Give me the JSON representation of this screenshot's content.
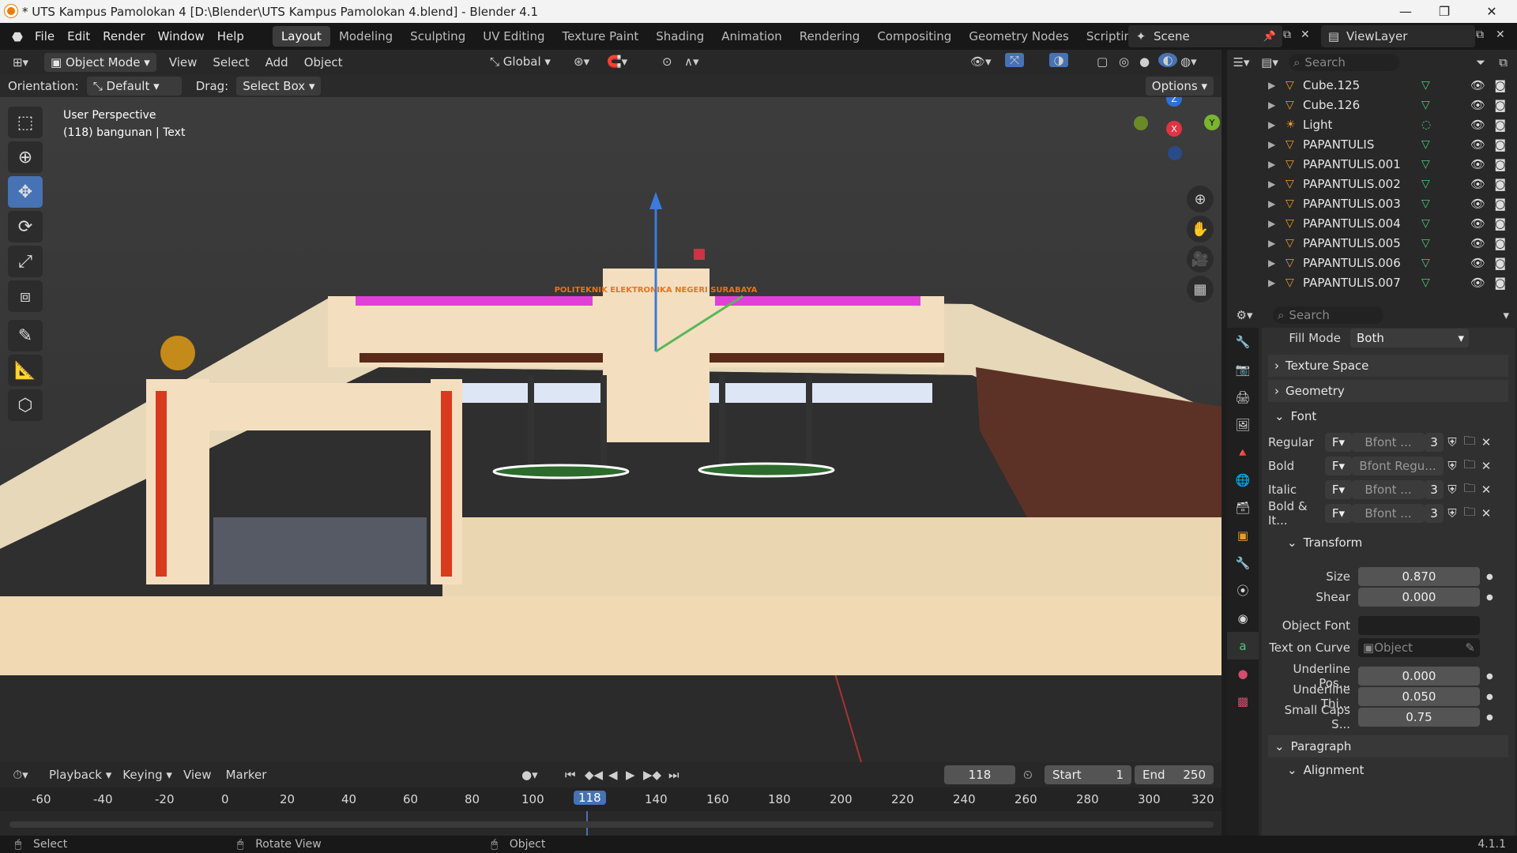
{
  "window": {
    "title": "* UTS Kampus Pamolokan 4 [D:\\Blender\\UTS Kampus Pamolokan 4.blend] - Blender 4.1",
    "controls": [
      "—",
      "❐",
      "✕"
    ]
  },
  "menubar": {
    "menus": [
      "File",
      "Edit",
      "Render",
      "Window",
      "Help"
    ],
    "workspaces": [
      "Layout",
      "Modeling",
      "Sculpting",
      "UV Editing",
      "Texture Paint",
      "Shading",
      "Animation",
      "Rendering",
      "Compositing",
      "Geometry Nodes",
      "Scripting"
    ],
    "active_workspace": "Layout",
    "scene": "Scene",
    "view_layer": "ViewLayer"
  },
  "viewport_header": {
    "mode": "Object Mode",
    "menus": [
      "View",
      "Select",
      "Add",
      "Object"
    ],
    "transform_orientation": "Global",
    "orientation_label": "Orientation:",
    "orientation_value": "Default",
    "drag_label": "Drag:",
    "drag_value": "Select Box",
    "options_label": "Options"
  },
  "viewport": {
    "perspective": "User Perspective",
    "object_info": "(118) bangunan | Text",
    "sign_text": "POLITEKNIK ELEKTRONIKA NEGERI SURABAYA",
    "gizmo": {
      "z": "Z",
      "y": "Y",
      "x": "X"
    },
    "tools": [
      "select-box-tool",
      "cursor-tool",
      "move-tool",
      "rotate-tool",
      "scale-tool",
      "transform-tool",
      "annotate-tool",
      "measure-tool",
      "add-cube-tool"
    ],
    "active_tool": "move-tool"
  },
  "outliner": {
    "search_placeholder": "Search",
    "items": [
      {
        "name": "Cube.125",
        "type": "mesh"
      },
      {
        "name": "Cube.126",
        "type": "mesh"
      },
      {
        "name": "Light",
        "type": "light"
      },
      {
        "name": "PAPANTULIS",
        "type": "mesh"
      },
      {
        "name": "PAPANTULIS.001",
        "type": "mesh"
      },
      {
        "name": "PAPANTULIS.002",
        "type": "mesh"
      },
      {
        "name": "PAPANTULIS.003",
        "type": "mesh"
      },
      {
        "name": "PAPANTULIS.004",
        "type": "mesh"
      },
      {
        "name": "PAPANTULIS.005",
        "type": "mesh"
      },
      {
        "name": "PAPANTULIS.006",
        "type": "mesh"
      },
      {
        "name": "PAPANTULIS.007",
        "type": "mesh"
      }
    ]
  },
  "properties": {
    "search_placeholder": "Search",
    "fill_mode_label": "Fill Mode",
    "fill_mode_value": "Both",
    "texture_space_label": "Texture Space",
    "geometry_label": "Geometry",
    "font_label": "Font",
    "fonts": [
      {
        "label": "Regular",
        "value": "Bfont ...",
        "users": "3"
      },
      {
        "label": "Bold",
        "value": "Bfont Regu...",
        "users": ""
      },
      {
        "label": "Italic",
        "value": "Bfont ...",
        "users": "3"
      },
      {
        "label": "Bold & It...",
        "value": "Bfont ...",
        "users": "3"
      }
    ],
    "transform_label": "Transform",
    "size_label": "Size",
    "size_value": "0.870",
    "shear_label": "Shear",
    "shear_value": "0.000",
    "object_font_label": "Object Font",
    "text_on_curve_label": "Text on Curve",
    "text_on_curve_placeholder": "Object",
    "underline_pos_label": "Underline Pos...",
    "underline_pos_value": "0.000",
    "underline_thi_label": "Underline Thi...",
    "underline_thi_value": "0.050",
    "small_caps_label": "Small Caps S...",
    "small_caps_value": "0.75",
    "paragraph_label": "Paragraph",
    "alignment_label": "Alignment"
  },
  "timeline": {
    "menus": [
      "Playback",
      "Keying",
      "View",
      "Marker"
    ],
    "current_frame": "118",
    "start_label": "Start",
    "start_value": "1",
    "end_label": "End",
    "end_value": "250",
    "ruler": [
      "-60",
      "-40",
      "-20",
      "0",
      "20",
      "40",
      "60",
      "80",
      "100",
      "118",
      "140",
      "160",
      "180",
      "200",
      "220",
      "240",
      "260",
      "280",
      "300",
      "320"
    ]
  },
  "statusbar": {
    "select": "Select",
    "rotate": "Rotate View",
    "object": "Object",
    "version": "4.1.1"
  }
}
